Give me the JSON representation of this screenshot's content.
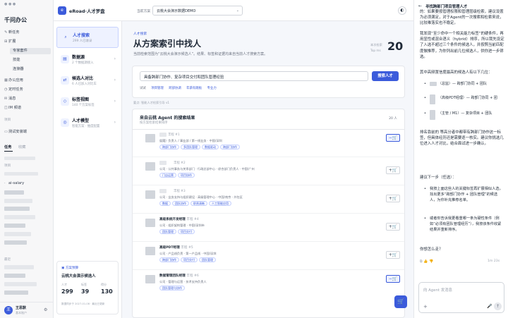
{
  "sidebar": {
    "app_title": "千问办公",
    "nav": [
      {
        "label": "新任务",
        "icon": "compose-icon"
      },
      {
        "label": "扩展",
        "icon": "extension-icon"
      },
      {
        "label": "专家套件",
        "icon": ""
      },
      {
        "label": "技能",
        "icon": ""
      },
      {
        "label": "连接器",
        "icon": ""
      },
      {
        "label": "办公应用",
        "icon": "apps-icon"
      },
      {
        "label": "定时任务",
        "icon": "clock-icon"
      },
      {
        "label": "消息",
        "icon": "message-icon"
      },
      {
        "label": "IM 频道",
        "icon": "channel-icon"
      }
    ],
    "section_project": "项目",
    "project_item": "测试安装端",
    "tabs": [
      "任务",
      "收藏"
    ],
    "recent": "最近",
    "group_label": "项目",
    "task_item": "ai-salary",
    "user_name": "王思默",
    "user_sub": "基本账户"
  },
  "topbar": {
    "brand": "eRoad·人才罗盘",
    "scheme_label": "当前方案",
    "scheme_value": "云桃大会演示数据DEMO"
  },
  "leftnav": [
    {
      "title": "人才搜索",
      "sub": "299 人已收录"
    },
    {
      "title": "数据源",
      "sub": "2 个数据源接入"
    },
    {
      "title": "候选人对比",
      "sub": "6 人已加入对比车"
    },
    {
      "title": "标签视图",
      "sub": "140 个方案标签"
    },
    {
      "title": "人才模型",
      "sub": "智能方案 · 维度配置"
    }
  ],
  "scheme_card": {
    "tag": "方案预算",
    "title": "云桃大会演示候选人",
    "stats": [
      {
        "label": "人才",
        "value": "299"
      },
      {
        "label": "标签",
        "value": "39"
      },
      {
        "label": "得分",
        "value": "130"
      }
    ],
    "footer": "数据同步于 2027-01-08 · 最近已更新"
  },
  "search": {
    "kicker": "人才搜索",
    "title": "从方案索引中找人",
    "desc": "当前检索范围为“云桃大会演示候选人”。结果、标签和证据均来自当前人才搜索方案。",
    "count_label": "本次检索",
    "count_sub": "Top ms",
    "count_value": "20",
    "query": "具备跨部门协作、复杂项目交付和团队管理经验",
    "button": "搜索人才",
    "hint_label": "试试",
    "hints": [
      "项目管理",
      "跨部协调",
      "年薪有跳板",
      "专业力"
    ],
    "refresh_note": "要点: 智能人才检索引导 v1"
  },
  "results": {
    "header": "来自云桃 Agent 的搜索结果",
    "sub": "按方案检索结果排序",
    "count": "20 人",
    "items": [
      {
        "score": "丰程 #1",
        "meta": "公司 · 负责人 / 事业部 / 第一线业务 · 中国/深圳",
        "chips": [
          "跨部门协作",
          "多团队管理",
          "数据驱动",
          "跨部门协作"
        ],
        "added": true
      },
      {
        "score": "丰程 #2",
        "meta": "公司 · 公共事务与关系部门 · 行政总部中心 · 综合部门负责人 · 中国/广州",
        "chips": [
          "门店运营",
          "项目协作"
        ],
        "added": false
      },
      {
        "score": "丰程 #3",
        "meta": "公司 · 业务支持与组织建设 · 高级管理中心 · 中国/南京 · 外包区",
        "chips": [
          "数据",
          "团队协作",
          "职责清晰",
          "人工智能应用"
        ],
        "added": false
      },
      {
        "score": "丰程 #4",
        "name": "高级系统开发经理",
        "meta": "公司 · 组织架构管理 · 中国/深圳市",
        "chips": [
          "团队管理",
          "项目交付"
        ],
        "added": false
      },
      {
        "score": "丰程 #5",
        "name": "高级PDT经理",
        "meta": "公司 · 产品线负责 · 第一产品线 · 中国/深圳",
        "chips": [
          "跨部门协作",
          "项目交付",
          "团队管理"
        ],
        "added": false
      },
      {
        "score": "丰程 #6",
        "name": "数据管理团队经理",
        "meta": "公司 · 管理与运营 · 技术支持负责人",
        "chips": [
          "团队管理与协作"
        ],
        "added": true
      }
    ]
  },
  "chat": {
    "title": "寻找跨部门项目管理人才",
    "paragraphs": [
      "的：如果要按管理权限和管理层级检索，建议设置为必须满足，对于Agent的一次搜索和检索来说，比较难落实也不稳定。",
      "我发现“至少命中一个相关能力标签”的硬条件，再用显性或混合语义（hybrid）排序，所以我先设定了入选不超过三个条件的候选人，并按照当前匹配度做推荐，为你列出前几位候选人，供你进一步筛选。",
      "其中高频置信度最高的候选人有以下几位："
    ],
    "bullets": [
      "（总监）— 跨部门协同 + 团队",
      "（高级PDT经理）— 跨部门协同 + 团",
      "（主管 / M1）— 复杂项目 + 团队"
    ],
    "para2": "排名靠前的 等高分者中都带有跨部门协作这一标签，但具体经历还是需要逐一核实。建议你挑选几位进入人才对比，结合面试进一步确认。",
    "next_title": "建议下一步（任选）：",
    "next_items": [
      "我按上面这些人的关键标签再扩展相似人选，找出更多“跨部门协作 + 团队管理”的候选人，为你补充推荐名单。",
      "或者你告诉我更看重哪一条为硬性条件（例如“必须有团队管理经历”），我按该条件收紧结果并重新排序。"
    ],
    "question": "你想怎么走？",
    "time": "1m 23s",
    "input_placeholder": "向 Agent 发消息"
  }
}
